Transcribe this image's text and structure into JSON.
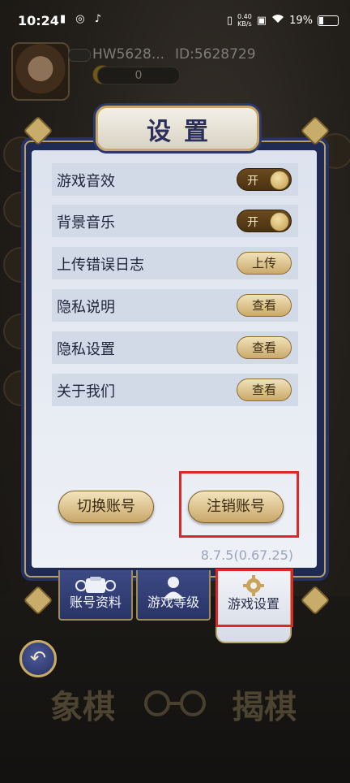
{
  "status_bar": {
    "time": "10:24",
    "left_icons": "▮ ◎ ♪",
    "net_speed_value": "0.40",
    "net_speed_unit": "KB/s",
    "battery": "19%"
  },
  "player": {
    "name": "HW5628...",
    "id": "ID:5628729",
    "coins": "0"
  },
  "dialog": {
    "title": "设置",
    "rows": [
      {
        "label": "游戏音效",
        "control": "toggle",
        "value": "开"
      },
      {
        "label": "背景音乐",
        "control": "toggle",
        "value": "开"
      },
      {
        "label": "上传错误日志",
        "control": "button",
        "value": "上传"
      },
      {
        "label": "隐私说明",
        "control": "button",
        "value": "查看"
      },
      {
        "label": "隐私设置",
        "control": "button",
        "value": "查看"
      },
      {
        "label": "关于我们",
        "control": "button",
        "value": "查看"
      }
    ],
    "switch_account": "切换账号",
    "delete_account": "注销账号",
    "version": "8.7.5(0.67.25)"
  },
  "tabs": [
    {
      "label": "账号资料",
      "icon": "account-card-icon",
      "active": false
    },
    {
      "label": "游戏等级",
      "icon": "person-icon",
      "active": false
    },
    {
      "label": "游戏设置",
      "icon": "gear-icon",
      "active": true
    }
  ],
  "bottom_logo": {
    "left": "象棋",
    "right": "揭棋"
  },
  "colors": {
    "highlight": "#e02626",
    "gold": "#c9a768",
    "navy": "#1f2a55"
  }
}
